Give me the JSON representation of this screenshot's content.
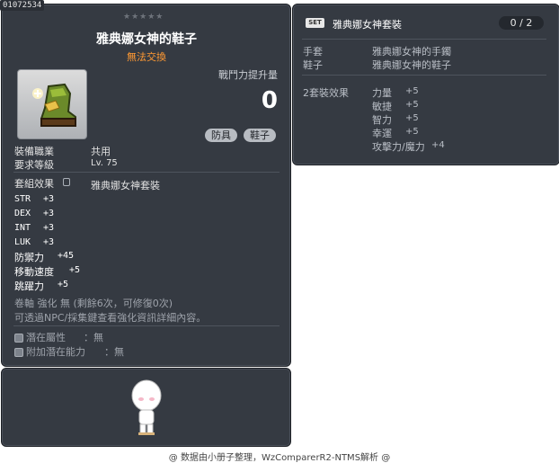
{
  "item_id": "01072534",
  "stars": "★★★★★",
  "title": "雅典娜女神的鞋子",
  "untradeable": "無法交換",
  "combat_power": {
    "label": "戰鬥力提升量",
    "value": "0"
  },
  "tags": [
    "防具",
    "鞋子"
  ],
  "job": {
    "label": "裝備職業",
    "value": "共用"
  },
  "level": {
    "label": "要求等級",
    "value": "Lv. 75"
  },
  "set_effect": {
    "label": "套組效果",
    "value": "雅典娜女神套裝"
  },
  "stats": [
    {
      "name": "STR",
      "value": "+3"
    },
    {
      "name": "DEX",
      "value": "+3"
    },
    {
      "name": "INT",
      "value": "+3"
    },
    {
      "name": "LUK",
      "value": "+3"
    }
  ],
  "big_stats": [
    {
      "name": "防禦力",
      "value": "+45"
    },
    {
      "name": "移動速度",
      "value": "+5"
    },
    {
      "name": "跳躍力",
      "value": "+5"
    }
  ],
  "scroll_info": "卷軸 強化 無 (剩餘6次，可修復0次)",
  "npc_info": "可透過NPC/採集鍵查看強化資訊詳細內容。",
  "potential": {
    "label": "潛在屬性",
    "value": "：無"
  },
  "bonus_potential": {
    "label": "附加潛在能力",
    "value": "：無"
  },
  "set_panel": {
    "badge": "SET",
    "name": "雅典娜女神套裝",
    "count": "0 / 2",
    "items": [
      {
        "slot": "手套",
        "name": "雅典娜女神的手鐲"
      },
      {
        "slot": "鞋子",
        "name": "雅典娜女神的鞋子"
      }
    ],
    "bonus_label": "2套裝效果",
    "bonuses": [
      {
        "name": "力量",
        "value": "+5"
      },
      {
        "name": "敏捷",
        "value": "+5"
      },
      {
        "name": "智力",
        "value": "+5"
      },
      {
        "name": "幸運",
        "value": "+5"
      },
      {
        "name": "攻擊力/魔力",
        "value": "+4"
      }
    ]
  },
  "footer": "@ 数据由小册子整理，WzComparerR2-NTMS解析 @",
  "colors": {
    "panel": "#353a42",
    "title": "#ffffff",
    "untradeable": "#ff9933"
  },
  "icons": [
    "boot-icon",
    "lock-icon",
    "avatar-icon",
    "set-badge-icon"
  ]
}
